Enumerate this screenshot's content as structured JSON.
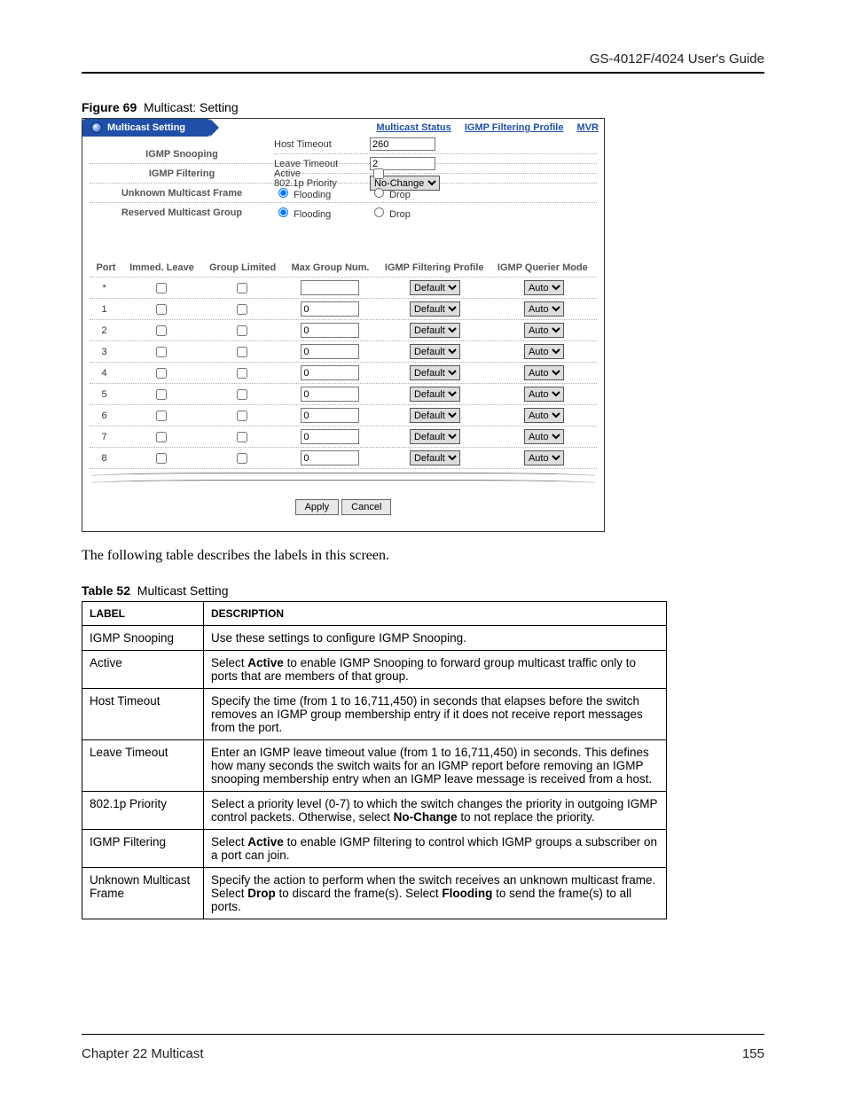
{
  "header": {
    "guide_title": "GS-4012F/4024 User's Guide"
  },
  "figure": {
    "prefix": "Figure 69",
    "caption": "Multicast: Setting"
  },
  "app": {
    "tab_title": "Multicast Setting",
    "links": {
      "status": "Multicast Status",
      "profile": "IGMP Filtering Profile",
      "mvr": "MVR"
    },
    "rows": {
      "igmp_snooping": "IGMP Snooping",
      "active": "Active",
      "host_timeout": "Host Timeout",
      "host_timeout_val": "260",
      "leave_timeout": "Leave Timeout",
      "leave_timeout_val": "2",
      "priority": "802.1p Priority",
      "priority_val": "No-Change",
      "igmp_filtering": "IGMP Filtering",
      "umf": "Unknown Multicast Frame",
      "rmg": "Reserved Multicast Group",
      "flooding": "Flooding",
      "drop": "Drop"
    },
    "port_head": {
      "port": "Port",
      "il": "Immed. Leave",
      "gl": "Group Limited",
      "mg": "Max Group Num.",
      "fp": "IGMP Filtering Profile",
      "qm": "IGMP Querier Mode"
    },
    "ports": [
      {
        "port": "*",
        "mg": "",
        "fp": "Default",
        "qm": "Auto"
      },
      {
        "port": "1",
        "mg": "0",
        "fp": "Default",
        "qm": "Auto"
      },
      {
        "port": "2",
        "mg": "0",
        "fp": "Default",
        "qm": "Auto"
      },
      {
        "port": "3",
        "mg": "0",
        "fp": "Default",
        "qm": "Auto"
      },
      {
        "port": "4",
        "mg": "0",
        "fp": "Default",
        "qm": "Auto"
      },
      {
        "port": "5",
        "mg": "0",
        "fp": "Default",
        "qm": "Auto"
      },
      {
        "port": "6",
        "mg": "0",
        "fp": "Default",
        "qm": "Auto"
      },
      {
        "port": "7",
        "mg": "0",
        "fp": "Default",
        "qm": "Auto"
      },
      {
        "port": "8",
        "mg": "0",
        "fp": "Default",
        "qm": "Auto"
      }
    ],
    "buttons": {
      "apply": "Apply",
      "cancel": "Cancel"
    }
  },
  "intro": "The following table describes the labels in this screen.",
  "table": {
    "prefix": "Table 52",
    "caption": "Multicast Setting",
    "head": {
      "label": "LABEL",
      "desc": "DESCRIPTION"
    },
    "rows": [
      {
        "label": "IGMP Snooping",
        "parts": [
          "Use these settings to configure IGMP Snooping."
        ]
      },
      {
        "label": "Active",
        "parts": [
          "Select ",
          "<b>Active</b>",
          " to enable IGMP Snooping to forward group multicast traffic only to ports that are members of that group."
        ]
      },
      {
        "label": "Host Timeout",
        "parts": [
          "Specify the time (from 1 to 16,711,450) in seconds that elapses before the switch removes an IGMP group membership entry if it does not receive report messages from the port."
        ]
      },
      {
        "label": "Leave Timeout",
        "parts": [
          "Enter an IGMP leave timeout value (from 1 to 16,711,450) in seconds. This defines how many seconds the switch waits for an IGMP report before removing an IGMP snooping membership entry when an IGMP leave message is received from a host."
        ]
      },
      {
        "label": "802.1p Priority",
        "parts": [
          "Select a priority level (0-7) to which the switch changes the priority in outgoing IGMP control packets. Otherwise, select ",
          "<b>No-Change</b>",
          " to not replace the priority."
        ]
      },
      {
        "label": "IGMP Filtering",
        "parts": [
          "Select ",
          "<b>Active</b>",
          " to enable IGMP filtering to control which IGMP groups a subscriber on a port can join."
        ]
      },
      {
        "label": "Unknown Multicast Frame",
        "parts": [
          "Specify the action to perform when the switch receives an unknown multicast frame. Select ",
          "<b>Drop</b>",
          " to discard the frame(s). Select ",
          "<b>Flooding</b>",
          " to send the frame(s) to all ports."
        ]
      }
    ]
  },
  "footer": {
    "chapter": "Chapter 22 Multicast",
    "page": "155"
  }
}
